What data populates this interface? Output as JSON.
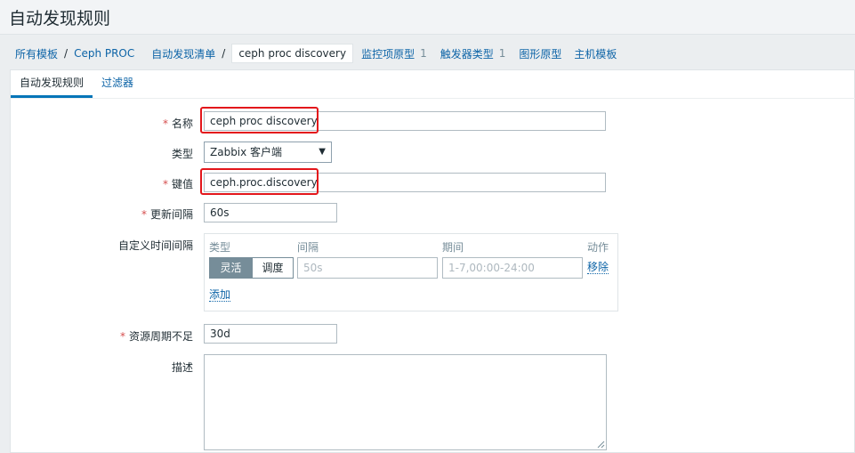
{
  "page": {
    "title": "自动发现规则"
  },
  "breadcrumbs": {
    "all_templates": "所有模板",
    "sep": "/",
    "template": "Ceph PROC",
    "discovery_list": "自动发现清单",
    "current": "ceph proc discovery",
    "item_prototypes": "监控项原型",
    "item_prototypes_count": "1",
    "trigger_prototypes": "触发器类型",
    "trigger_prototypes_count": "1",
    "graph_prototypes": "图形原型",
    "host_templates": "主机模板"
  },
  "tabs": {
    "discovery_rule": "自动发现规则",
    "filters": "过滤器"
  },
  "form": {
    "required_mark": "*",
    "name_label": "名称",
    "name_value": "ceph proc discovery",
    "type_label": "类型",
    "type_value": "Zabbix 客户端",
    "type_caret": "▼",
    "key_label": "键值",
    "key_value": "ceph.proc.discovery",
    "interval_label": "更新间隔",
    "interval_value": "60s",
    "custom_intervals_label": "自定义时间间隔",
    "custom_intervals": {
      "col_type": "类型",
      "col_interval": "间隔",
      "col_period": "期间",
      "col_action": "动作",
      "flexible_label": "灵活",
      "scheduling_label": "调度",
      "interval_placeholder": "50s",
      "period_placeholder": "1-7,00:00-24:00",
      "remove_label": "移除",
      "add_label": "添加"
    },
    "lifetime_label": "资源周期不足",
    "lifetime_value": "30d",
    "description_label": "描述",
    "description_value": ""
  },
  "colors": {
    "highlight": "#e3161b",
    "link": "#0d64a7",
    "required": "#d64e4e"
  }
}
